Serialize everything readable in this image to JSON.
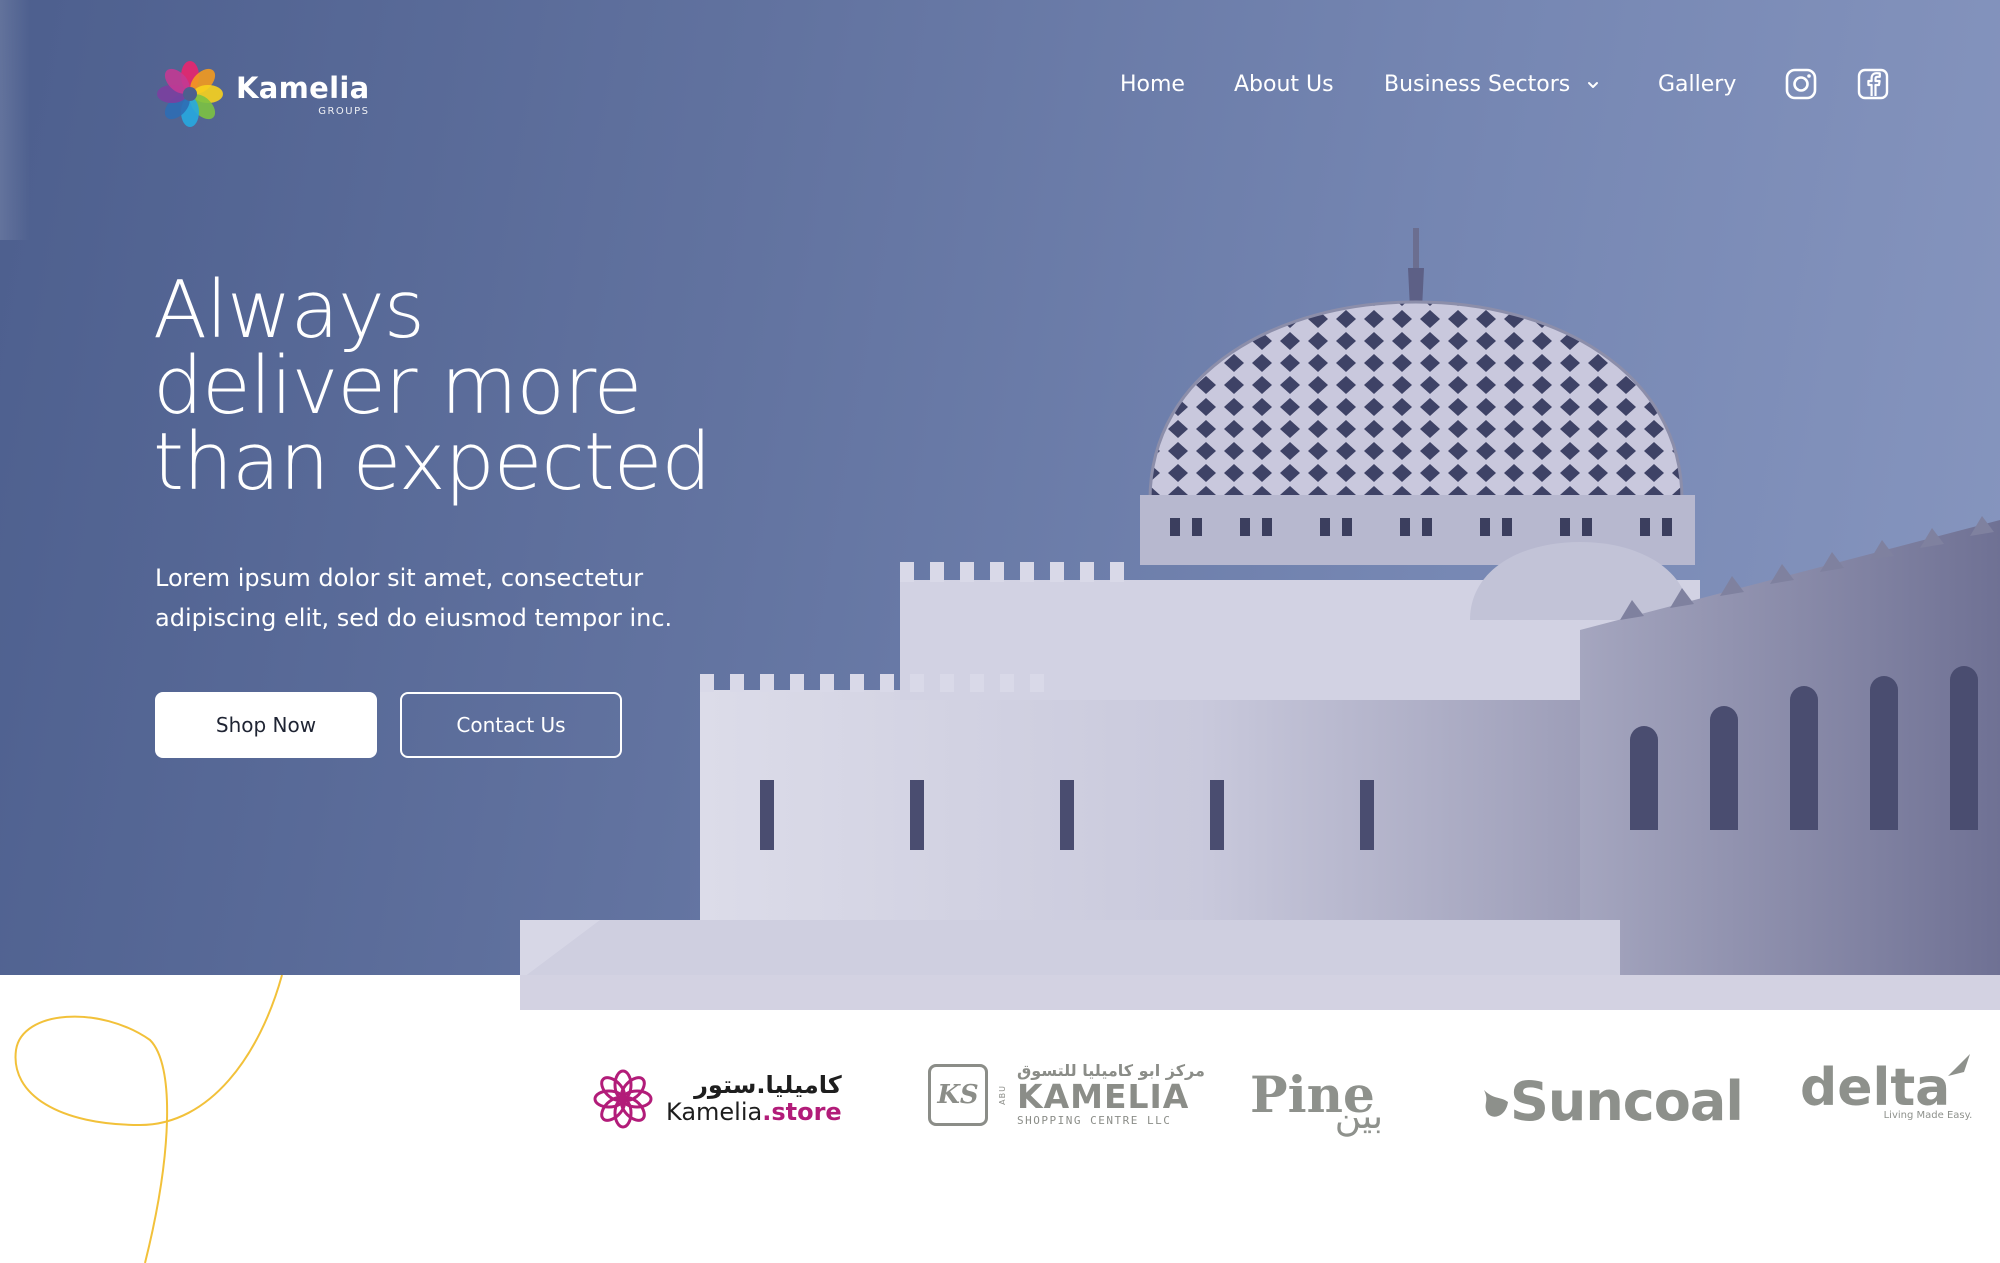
{
  "brand": {
    "name": "Kamelia",
    "subtitle": "GROUPS"
  },
  "nav": {
    "home": "Home",
    "about": "About Us",
    "business": "Business Sectors",
    "gallery": "Gallery"
  },
  "hero": {
    "headline_lines": [
      "Always",
      "deliver more",
      "than expected"
    ],
    "lead_lines": [
      "Lorem ipsum dolor sit amet, consectetur",
      "adipiscing elit, sed do eiusmod tempor inc."
    ],
    "shop_label": "Shop Now",
    "contact_label": "Contact Us"
  },
  "partners": {
    "kamelia_store": {
      "arabic": "كاميليا.ستور",
      "name_plain": "Kamelia",
      "name_accent": ".store"
    },
    "ks": {
      "monogram": "KS",
      "arabic": "مركز ابو كاميليا للتسوق",
      "vertical": "ABU",
      "name": "KAMELIA",
      "sub": "SHOPPING CENTRE LLC"
    },
    "pine": {
      "word": "Pine",
      "arabic": "بين"
    },
    "suncoal": {
      "word": "Suncoal"
    },
    "delta": {
      "word": "delta",
      "tagline": "Living Made Easy."
    }
  },
  "colors": {
    "hero_from": "#4d5f8e",
    "hero_to": "#8796bf",
    "accent_magenta": "#b21c79",
    "partner_gray": "#8d908b",
    "deco_line": "#f2c13a"
  }
}
